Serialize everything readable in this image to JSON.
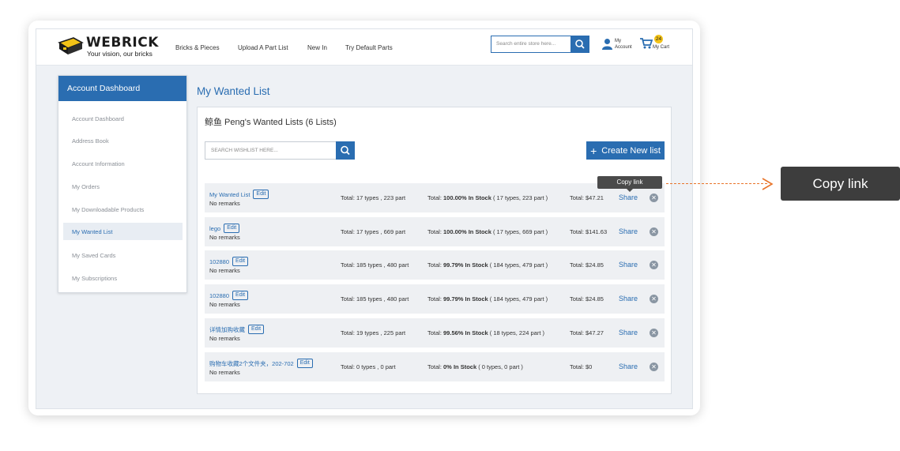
{
  "brand": {
    "name": "WEBRICK",
    "tagline": "Your vision, our bricks"
  },
  "nav": [
    "Bricks & Pieces",
    "Upload A Part List",
    "New In",
    "Try Default Parts"
  ],
  "search": {
    "placeholder": "Search entire store here..."
  },
  "account": {
    "line1": "My",
    "line2": "Account"
  },
  "cart": {
    "count": "24",
    "label": "My Cart"
  },
  "sidebar": {
    "title": "Account Dashboard",
    "items": [
      "Account Dashboard",
      "Address Book",
      "Account Information",
      "My Orders",
      "My Downloadable Products",
      "My Wanted List",
      "My Saved Cards",
      "My Subscriptions"
    ],
    "active_item": "My Wanted List"
  },
  "main": {
    "page_title": "My Wanted List",
    "panel_title": "鲸鱼 Peng's Wanted Lists (6 Lists)",
    "search_placeholder": "SEARCH WISHLIST HERE...",
    "create_label": "Create New list",
    "share_label": "Share",
    "edit_label": "Edit",
    "rows": [
      {
        "name": "My Wanted List",
        "remark": "No remarks",
        "types": "Total: 17 types , 223 part",
        "stock_prefix": "Total: ",
        "stock_pct": "100.00% In Stock",
        "stock_detail": " ( 17 types, 223 part )",
        "price": "Total: $47.21"
      },
      {
        "name": "lego",
        "remark": "No remarks",
        "types": "Total: 17 types , 669 part",
        "stock_prefix": "Total: ",
        "stock_pct": "100.00% In Stock",
        "stock_detail": " ( 17 types, 669 part )",
        "price": "Total: $141.63"
      },
      {
        "name": "102880",
        "remark": "No remarks",
        "types": "Total: 185 types , 480 part",
        "stock_prefix": "Total: ",
        "stock_pct": "99.79% In Stock",
        "stock_detail": " ( 184 types, 479 part )",
        "price": "Total: $24.85"
      },
      {
        "name": "102880",
        "remark": "No remarks",
        "types": "Total: 185 types , 480 part",
        "stock_prefix": "Total: ",
        "stock_pct": "99.79% In Stock",
        "stock_detail": " ( 184 types, 479 part )",
        "price": "Total: $24.85"
      },
      {
        "name": "详情加购收藏",
        "remark": "No remarks",
        "types": "Total: 19 types , 225 part",
        "stock_prefix": "Total: ",
        "stock_pct": "99.56% In Stock",
        "stock_detail": " ( 18 types, 224 part )",
        "price": "Total: $47.27"
      },
      {
        "name": "购物车收藏2个文件夹，202-702",
        "remark": "No remarks",
        "types": "Total: 0 types , 0 part",
        "stock_prefix": "Total: ",
        "stock_pct": "0% In Stock",
        "stock_detail": " ( 0 types, 0 part )",
        "price": "Total: $0"
      }
    ]
  },
  "tooltip": "Copy link",
  "callout": "Copy link",
  "colors": {
    "primary": "#2a6db1",
    "accent_arrow": "#e8742a",
    "cart_badge": "#f3c317"
  },
  "icons": [
    "brick-logo-icon",
    "search-icon",
    "user-icon",
    "cart-icon",
    "close-icon",
    "plus-icon",
    "arrow-right-icon"
  ]
}
